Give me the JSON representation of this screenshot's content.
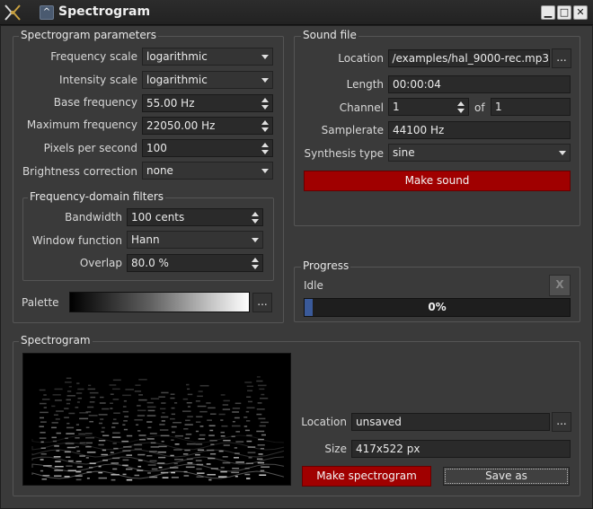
{
  "window": {
    "title": "Spectrogram",
    "menu_glyph": "^",
    "minimize_glyph": "▁",
    "maximize_glyph": "□",
    "close_glyph": "✕"
  },
  "params": {
    "group_title": "Spectrogram parameters",
    "frequency_scale": {
      "label": "Frequency scale",
      "value": "logarithmic"
    },
    "intensity_scale": {
      "label": "Intensity scale",
      "value": "logarithmic"
    },
    "base_frequency": {
      "label": "Base frequency",
      "value": "55.00 Hz"
    },
    "max_frequency": {
      "label": "Maximum frequency",
      "value": "22050.00 Hz"
    },
    "pixels_per_second": {
      "label": "Pixels per second",
      "value": "100"
    },
    "brightness": {
      "label": "Brightness correction",
      "value": "none"
    }
  },
  "filters": {
    "group_title": "Frequency-domain filters",
    "bandwidth": {
      "label": "Bandwidth",
      "value": "100 cents"
    },
    "window_function": {
      "label": "Window function",
      "value": "Hann"
    },
    "overlap": {
      "label": "Overlap",
      "value": "80.0 %"
    }
  },
  "palette": {
    "label": "Palette",
    "button": "..."
  },
  "sound": {
    "group_title": "Sound file",
    "location": {
      "label": "Location",
      "value": "/examples/hal_9000-rec.mp3",
      "button": "..."
    },
    "length": {
      "label": "Length",
      "value": "00:00:04"
    },
    "channel": {
      "label": "Channel",
      "value": "1",
      "of_label": "of",
      "total": "1"
    },
    "samplerate": {
      "label": "Samplerate",
      "value": "44100 Hz"
    },
    "synthesis": {
      "label": "Synthesis type",
      "value": "sine"
    },
    "make_sound": "Make sound"
  },
  "progress": {
    "group_title": "Progress",
    "status": "Idle",
    "cancel": "X",
    "percent": 0,
    "percent_text": "0%"
  },
  "spectrogram": {
    "group_title": "Spectrogram",
    "location": {
      "label": "Location",
      "value": "unsaved",
      "button": "..."
    },
    "size": {
      "label": "Size",
      "value": "417x522 px"
    },
    "make_button": "Make spectrogram",
    "save_button": "Save as"
  },
  "colors": {
    "accent_red": "#a00000",
    "background": "#3a3a3a",
    "field": "#2a2a2a"
  }
}
